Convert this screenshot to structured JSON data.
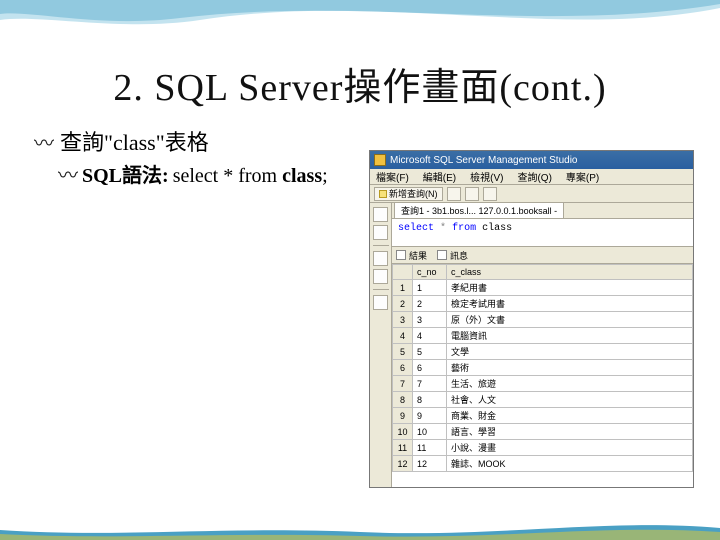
{
  "slide": {
    "title": "2. SQL Server操作畫面(cont.)",
    "bullet": "查詢\"class\"表格",
    "sub_label": "SQL語法:",
    "sql_select": "select",
    "sql_star": "*",
    "sql_from": "from",
    "sql_class": "class",
    "sql_semi": ";"
  },
  "ssms": {
    "app_title": "Microsoft SQL Server Management Studio",
    "menus": [
      "檔案(F)",
      "編輯(E)",
      "檢視(V)",
      "查詢(Q)",
      "專案(P)"
    ],
    "toolbar_new": "新增查詢(N)",
    "tab_label": "查詢1 - 3b1.bos.l... 127.0.0.1.booksall -",
    "editor_kw_select": "select",
    "editor_star": "*",
    "editor_kw_from": "from",
    "editor_ident": "class",
    "results_tab1": "結果",
    "results_tab2": "訊息",
    "columns": [
      "",
      "c_no",
      "c_class"
    ],
    "rows": [
      {
        "n": "1",
        "c_no": "1",
        "c_class": "孝紀用書"
      },
      {
        "n": "2",
        "c_no": "2",
        "c_class": "檢定考試用書"
      },
      {
        "n": "3",
        "c_no": "3",
        "c_class": "原（外）文書"
      },
      {
        "n": "4",
        "c_no": "4",
        "c_class": "電腦資訊"
      },
      {
        "n": "5",
        "c_no": "5",
        "c_class": "文學"
      },
      {
        "n": "6",
        "c_no": "6",
        "c_class": "藝術"
      },
      {
        "n": "7",
        "c_no": "7",
        "c_class": "生活、旅遊"
      },
      {
        "n": "8",
        "c_no": "8",
        "c_class": "社會、人文"
      },
      {
        "n": "9",
        "c_no": "9",
        "c_class": "商業、財金"
      },
      {
        "n": "10",
        "c_no": "10",
        "c_class": "語言、學習"
      },
      {
        "n": "11",
        "c_no": "11",
        "c_class": "小說、漫畫"
      },
      {
        "n": "12",
        "c_no": "12",
        "c_class": "雜誌、MOOK"
      }
    ]
  },
  "chart_data": {
    "type": "table",
    "title": "class",
    "columns": [
      "c_no",
      "c_class"
    ],
    "rows": [
      [
        1,
        "孝紀用書"
      ],
      [
        2,
        "檢定考試用書"
      ],
      [
        3,
        "原（外）文書"
      ],
      [
        4,
        "電腦資訊"
      ],
      [
        5,
        "文學"
      ],
      [
        6,
        "藝術"
      ],
      [
        7,
        "生活、旅遊"
      ],
      [
        8,
        "社會、人文"
      ],
      [
        9,
        "商業、財金"
      ],
      [
        10,
        "語言、學習"
      ],
      [
        11,
        "小說、漫畫"
      ],
      [
        12,
        "雜誌、MOOK"
      ]
    ]
  }
}
